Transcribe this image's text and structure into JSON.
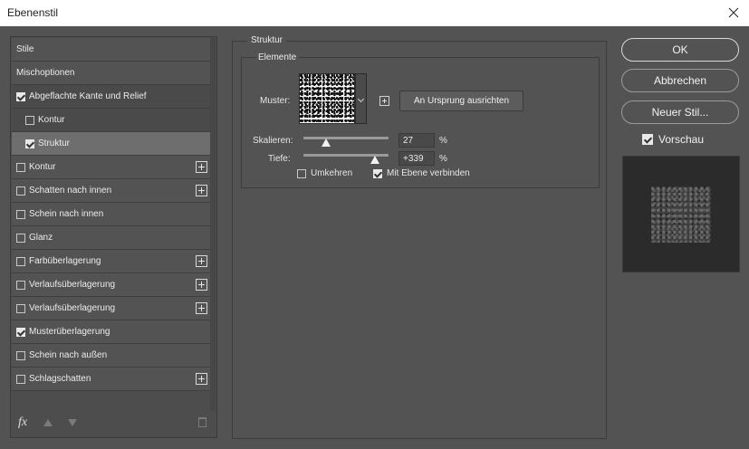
{
  "window": {
    "title": "Ebenenstil"
  },
  "sidebar": {
    "items": [
      {
        "label": "Stile",
        "checkbox": false,
        "checked": false,
        "add": false
      },
      {
        "label": "Mischoptionen",
        "checkbox": false,
        "checked": false,
        "add": false
      },
      {
        "label": "Abgeflachte Kante und Relief",
        "checkbox": true,
        "checked": true,
        "add": false
      },
      {
        "label": "Kontur",
        "checkbox": true,
        "checked": false,
        "add": false,
        "sub": true
      },
      {
        "label": "Struktur",
        "checkbox": true,
        "checked": true,
        "add": false,
        "sub": true,
        "selected": true
      },
      {
        "label": "Kontur",
        "checkbox": true,
        "checked": false,
        "add": true
      },
      {
        "label": "Schatten nach innen",
        "checkbox": true,
        "checked": false,
        "add": true
      },
      {
        "label": "Schein nach innen",
        "checkbox": true,
        "checked": false,
        "add": false
      },
      {
        "label": "Glanz",
        "checkbox": true,
        "checked": false,
        "add": false
      },
      {
        "label": "Farbüberlagerung",
        "checkbox": true,
        "checked": false,
        "add": true
      },
      {
        "label": "Verlaufsüberlagerung",
        "checkbox": true,
        "checked": false,
        "add": true
      },
      {
        "label": "Verlaufsüberlagerung",
        "checkbox": true,
        "checked": false,
        "add": true
      },
      {
        "label": "Musterüberlagerung",
        "checkbox": true,
        "checked": true,
        "add": false
      },
      {
        "label": "Schein nach außen",
        "checkbox": true,
        "checked": false,
        "add": false
      },
      {
        "label": "Schlagschatten",
        "checkbox": true,
        "checked": false,
        "add": true
      }
    ],
    "fx_label": "fx"
  },
  "struktur": {
    "group_title": "Struktur",
    "elemente_title": "Elemente",
    "muster_label": "Muster:",
    "origin_button": "An Ursprung ausrichten",
    "skalieren_label": "Skalieren:",
    "skalieren_value": "27",
    "skalieren_fraction": 0.27,
    "tiefe_label": "Tiefe:",
    "tiefe_value": "+339",
    "tiefe_fraction": 0.84,
    "percent": "%",
    "umkehren_label": "Umkehren",
    "umkehren_checked": false,
    "mit_ebene_label": "Mit Ebene verbinden",
    "mit_ebene_checked": true
  },
  "actions": {
    "ok": "OK",
    "cancel": "Abbrechen",
    "new_style": "Neuer Stil...",
    "preview_label": "Vorschau",
    "preview_checked": true
  }
}
